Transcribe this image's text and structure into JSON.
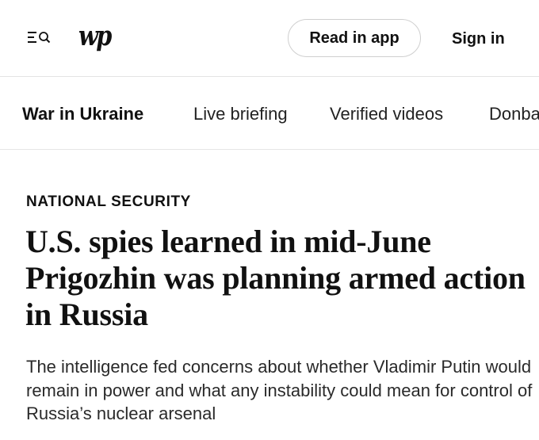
{
  "header": {
    "logo_text": "wp",
    "read_in_app_label": "Read in app",
    "sign_in_label": "Sign in"
  },
  "subnav": {
    "items": [
      {
        "label": "War in Ukraine"
      },
      {
        "label": "Live briefing"
      },
      {
        "label": "Verified videos"
      },
      {
        "label": "Donba"
      }
    ]
  },
  "article": {
    "kicker": "NATIONAL SECURITY",
    "headline": "U.S. spies learned in mid-June Prigozhin was planning armed action in Russia",
    "dek": "The intelligence fed concerns about whether Vladimir Putin would remain in power and what any instability could mean for control of Russia’s nuclear arsenal"
  },
  "icons": {
    "menu": "menu-icon",
    "search": "search-icon"
  },
  "colors": {
    "text": "#111111",
    "border": "#cfcfcf",
    "divider": "#e3e3e3",
    "background": "#ffffff"
  }
}
